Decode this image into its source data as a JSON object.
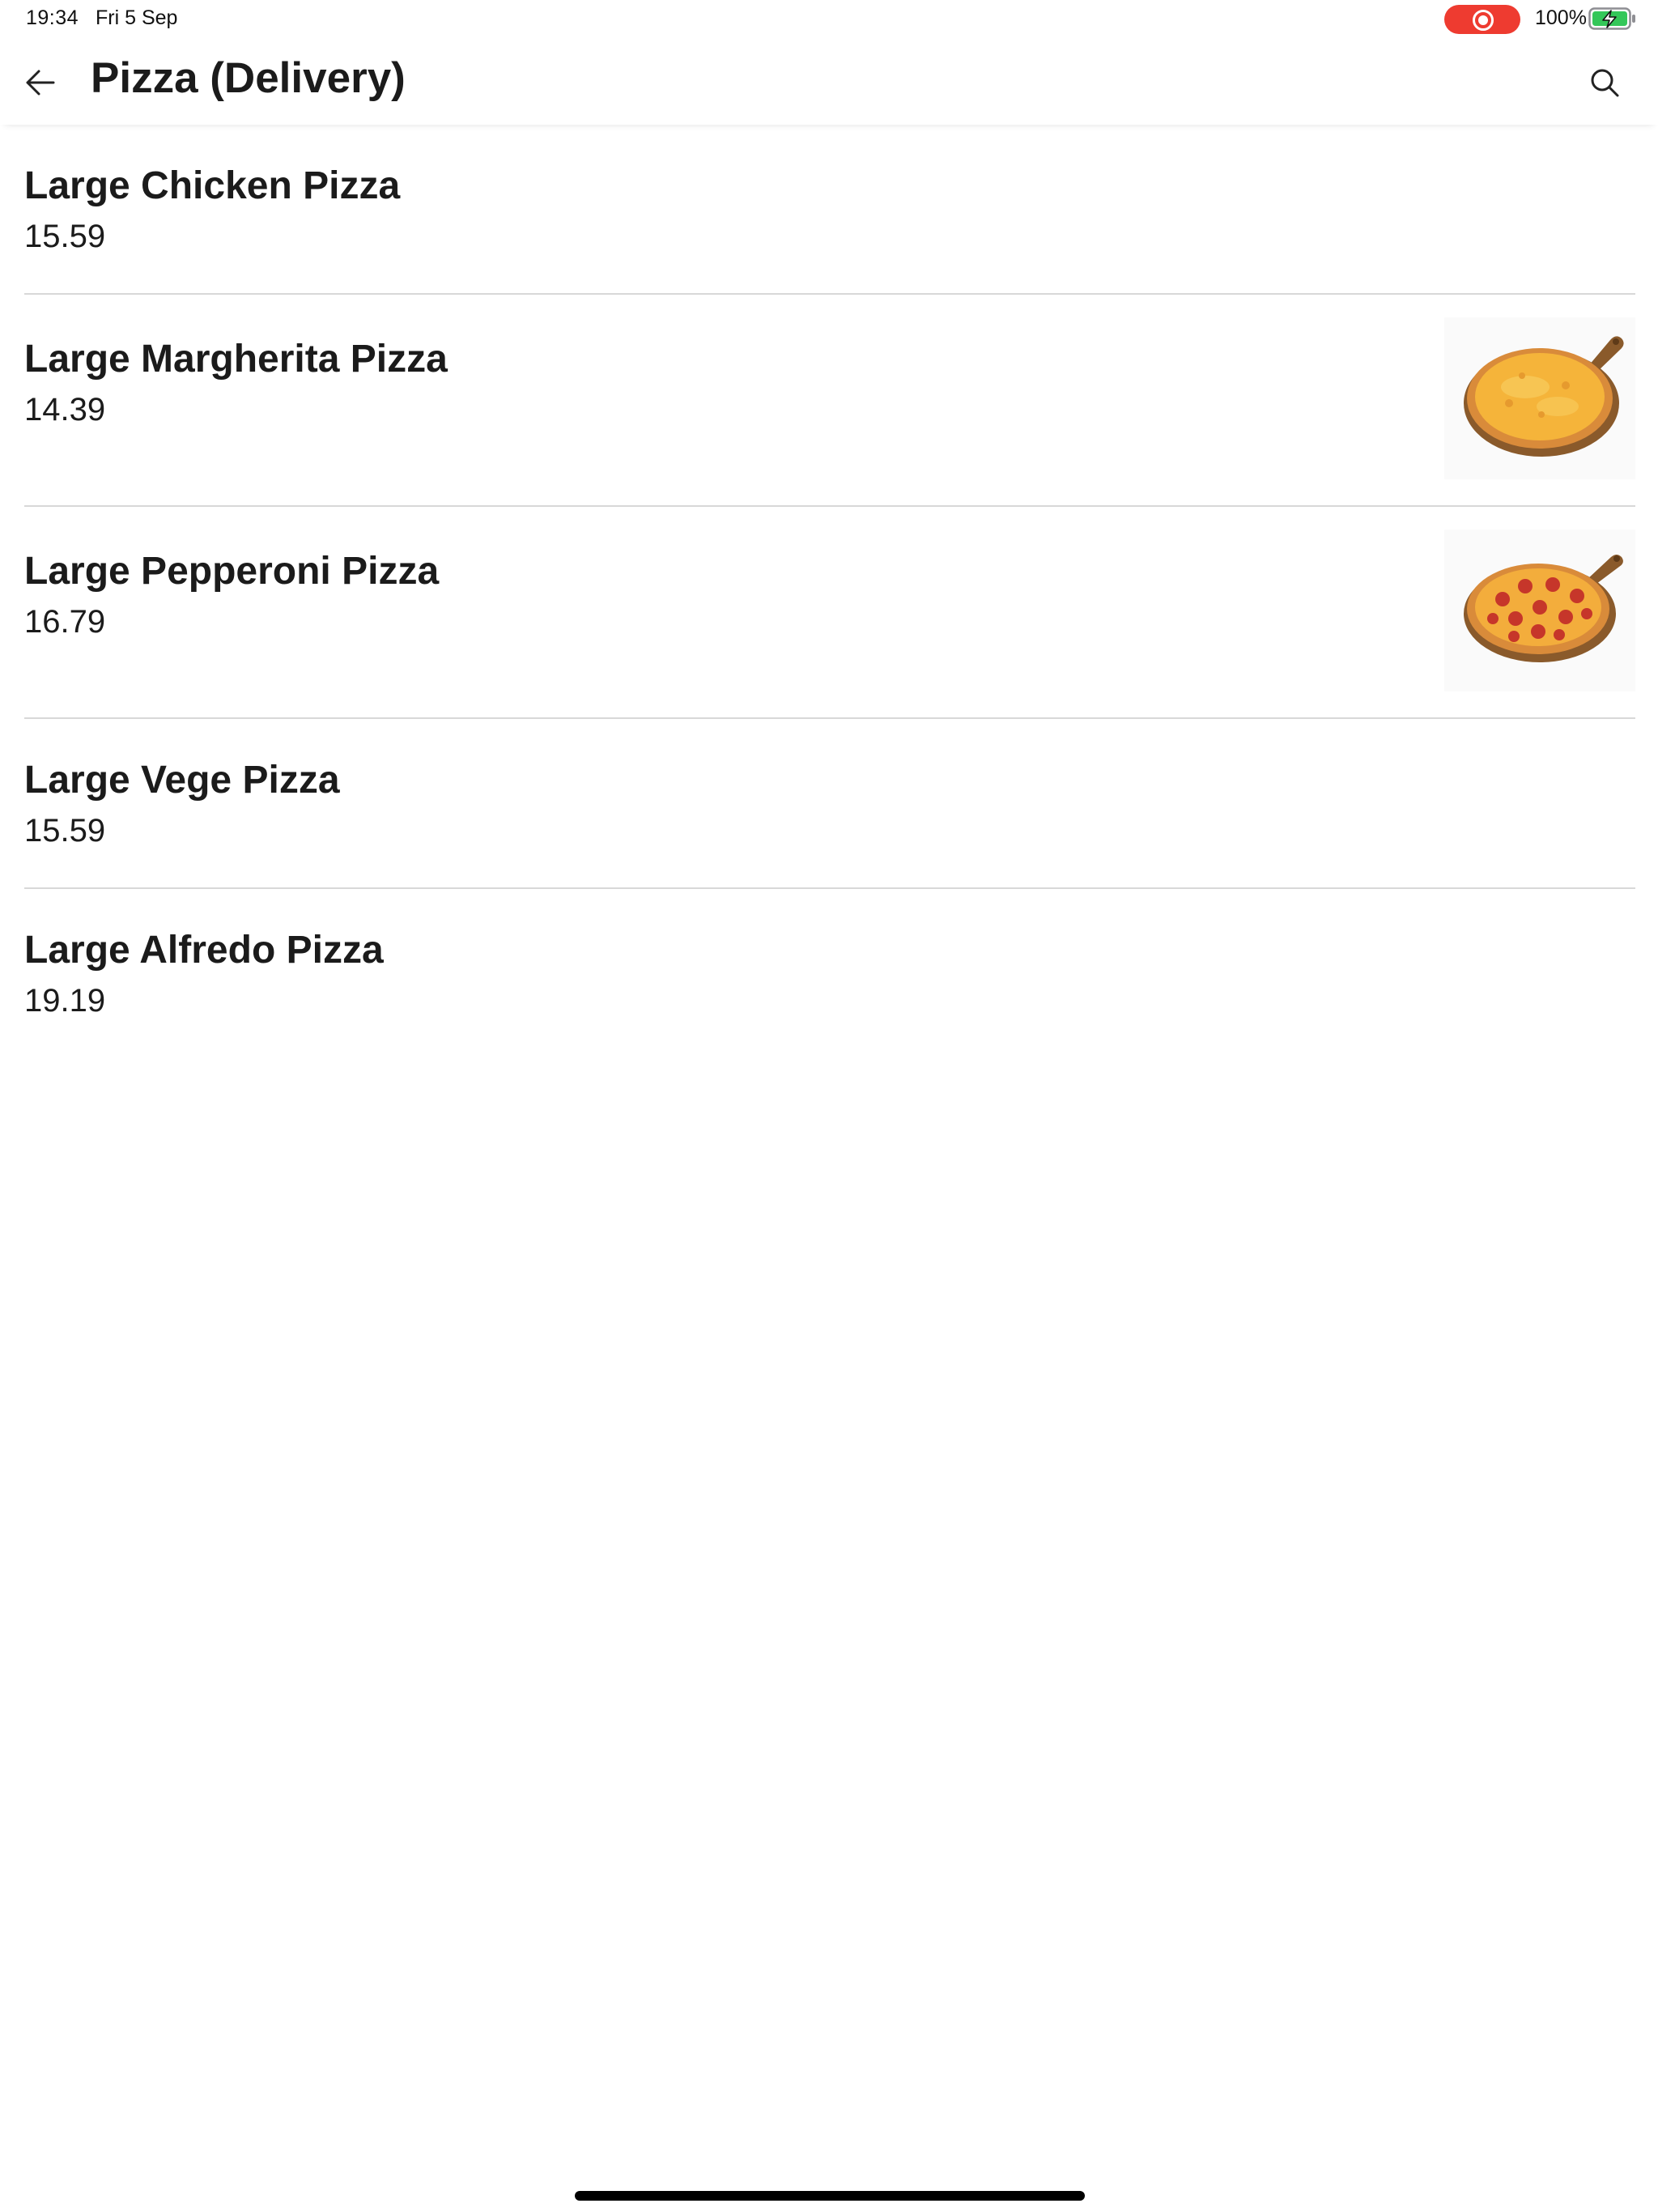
{
  "status_bar": {
    "time": "19:34",
    "date": "Fri 5 Sep",
    "battery": "100%"
  },
  "header": {
    "title": "Pizza (Delivery)",
    "back_icon": "arrow-left-icon",
    "search_icon": "search-icon"
  },
  "menu": {
    "items": [
      {
        "name": "Large Chicken Pizza",
        "price": "15.59",
        "has_image": false
      },
      {
        "name": "Large Margherita Pizza",
        "price": "14.39",
        "has_image": true,
        "image": "cheese-pizza"
      },
      {
        "name": "Large Pepperoni Pizza",
        "price": "16.79",
        "has_image": true,
        "image": "pepperoni-pizza"
      },
      {
        "name": "Large Vege Pizza",
        "price": "15.59",
        "has_image": false
      },
      {
        "name": "Large Alfredo Pizza",
        "price": "19.19",
        "has_image": false
      }
    ]
  },
  "colors": {
    "record_indicator": "#ee3b30",
    "battery_charging": "#34c759",
    "divider": "#d8d8d8",
    "cheese": "#f5b43a",
    "crust": "#d98b3a",
    "pepperoni": "#c6362a",
    "board": "#8a5a2b"
  }
}
